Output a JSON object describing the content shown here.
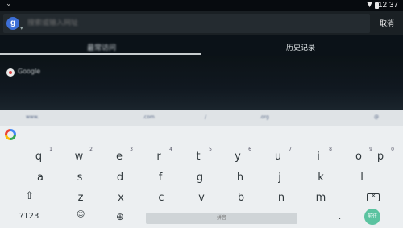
{
  "status_bar": {
    "time": "12:37"
  },
  "search": {
    "placeholder": "搜索或输入网址",
    "cancel_label": "取消"
  },
  "tabs": {
    "frequent": "最常访问",
    "history": "历史记录"
  },
  "sites": [
    {
      "label": "Google"
    }
  ],
  "keyboard": {
    "suggestions": [
      "www.",
      ".com",
      "/",
      ".org",
      "@"
    ],
    "row1": [
      {
        "key": "q",
        "hint": "1"
      },
      {
        "key": "w",
        "hint": "2"
      },
      {
        "key": "e",
        "hint": "3"
      },
      {
        "key": "r",
        "hint": "4"
      },
      {
        "key": "t",
        "hint": "5"
      },
      {
        "key": "y",
        "hint": "6"
      },
      {
        "key": "u",
        "hint": "7"
      },
      {
        "key": "i",
        "hint": "8"
      },
      {
        "key": "o",
        "hint": "9"
      },
      {
        "key": "p",
        "hint": "0"
      }
    ],
    "row2": [
      "a",
      "s",
      "d",
      "f",
      "g",
      "h",
      "j",
      "k",
      "l"
    ],
    "row3": [
      "z",
      "x",
      "c",
      "v",
      "b",
      "n",
      "m"
    ],
    "sym_label": "?123",
    "space_label": "拼音",
    "period_label": ".",
    "enter_label": "前往"
  }
}
